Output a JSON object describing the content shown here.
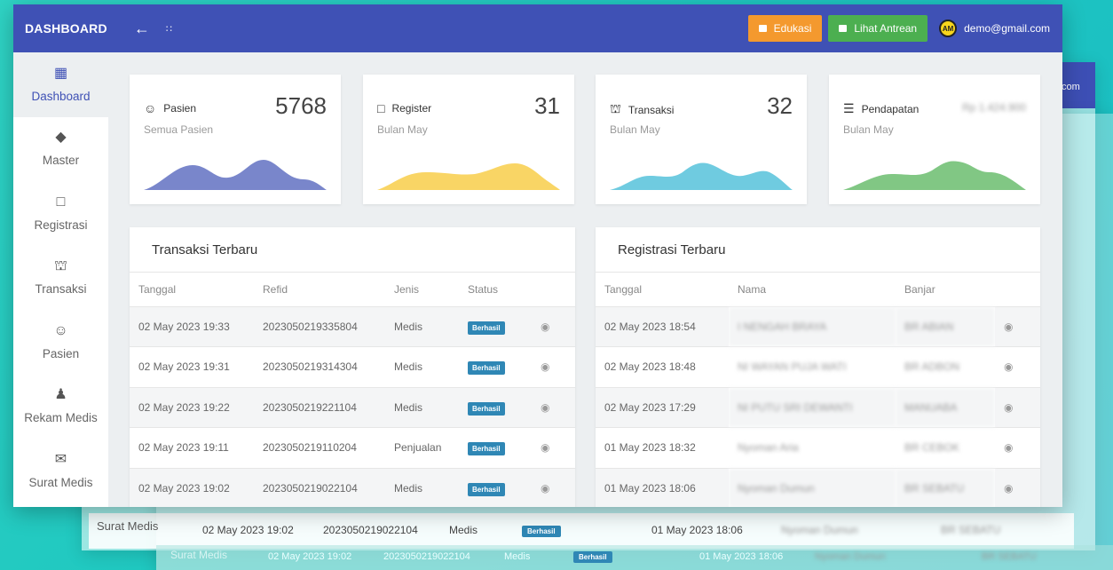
{
  "topbar": {
    "brand": "DASHBOARD",
    "back_icon": "arrow-left-icon",
    "menu_icon": "dots-icon",
    "btn_edukasi": "Edukasi",
    "btn_antrean": "Lihat Antrean",
    "email": "demo@gmail.com",
    "brand_color": "#3f51b5"
  },
  "sidebar": {
    "items": [
      {
        "label": "Dashboard",
        "icon": "dashboard-icon"
      },
      {
        "label": "Master",
        "icon": "layers-icon"
      },
      {
        "label": "Registrasi",
        "icon": "clipboard-icon"
      },
      {
        "label": "Transaksi",
        "icon": "cart-icon"
      },
      {
        "label": "Pasien",
        "icon": "face-icon"
      },
      {
        "label": "Rekam Medis",
        "icon": "person-icon"
      },
      {
        "label": "Surat Medis",
        "icon": "mail-icon"
      }
    ]
  },
  "stats": [
    {
      "title": "Pasien",
      "sub": "Semua Pasien",
      "value": "5768",
      "color": "#7986cb",
      "icon": "face-icon"
    },
    {
      "title": "Register",
      "sub": "Bulan May",
      "value": "31",
      "color": "#f9d565",
      "icon": "clipboard-icon"
    },
    {
      "title": "Transaksi",
      "sub": "Bulan May",
      "value": "32",
      "color": "#6fcbe0",
      "icon": "cart-icon"
    },
    {
      "title": "Pendapatan",
      "sub": "Bulan May",
      "value": "Rp 1.424.900",
      "color": "#81c784",
      "icon": "list-icon"
    }
  ],
  "transaksi": {
    "title": "Transaksi Terbaru",
    "columns": [
      "Tanggal",
      "Refid",
      "Jenis",
      "Status"
    ],
    "rows": [
      {
        "tanggal": "02 May 2023 19:33",
        "refid": "2023050219335804",
        "jenis": "Medis",
        "status": "Berhasil"
      },
      {
        "tanggal": "02 May 2023 19:31",
        "refid": "2023050219314304",
        "jenis": "Medis",
        "status": "Berhasil"
      },
      {
        "tanggal": "02 May 2023 19:22",
        "refid": "2023050219221104",
        "jenis": "Medis",
        "status": "Berhasil"
      },
      {
        "tanggal": "02 May 2023 19:11",
        "refid": "2023050219110204",
        "jenis": "Penjualan",
        "status": "Berhasil"
      },
      {
        "tanggal": "02 May 2023 19:02",
        "refid": "2023050219022104",
        "jenis": "Medis",
        "status": "Berhasil"
      }
    ]
  },
  "registrasi": {
    "title": "Registrasi Terbaru",
    "columns": [
      "Tanggal",
      "Nama",
      "Banjar"
    ],
    "rows": [
      {
        "tanggal": "02 May 2023 18:54",
        "nama": "I NENGAH BRAYA",
        "banjar": "BR ABIAN"
      },
      {
        "tanggal": "02 May 2023 18:48",
        "nama": "NI WAYAN PUJA WATI",
        "banjar": "BR ADBON"
      },
      {
        "tanggal": "02 May 2023 17:29",
        "nama": "NI PUTU SRI DEWANTI",
        "banjar": "MANUABA"
      },
      {
        "tanggal": "01 May 2023 18:32",
        "nama": "Nyoman Aria",
        "banjar": "BR CEBOK"
      },
      {
        "tanggal": "01 May 2023 18:06",
        "nama": "Nyoman Dumun",
        "banjar": "BR SEBATU"
      }
    ]
  },
  "ghost": {
    "side_label": "Surat Medis",
    "row1": {
      "tanggal": "02 May 2023 19:02",
      "refid": "2023050219022104",
      "jenis": "Medis",
      "status": "Berhasil",
      "reg_tanggal": "01 May 2023 18:06",
      "nama": "Nyoman Dumun",
      "banjar": "BR SEBATU"
    },
    "row2": {
      "tanggal": "02 May 2023 19:02",
      "refid": "2023050219022104",
      "jenis": "Medis",
      "status": "Berhasil",
      "reg_tanggal": "01 May 2023 18:06",
      "nama": "Nyoman Dumun",
      "banjar": "BR SEBATU"
    },
    "email_fragment": "com"
  }
}
